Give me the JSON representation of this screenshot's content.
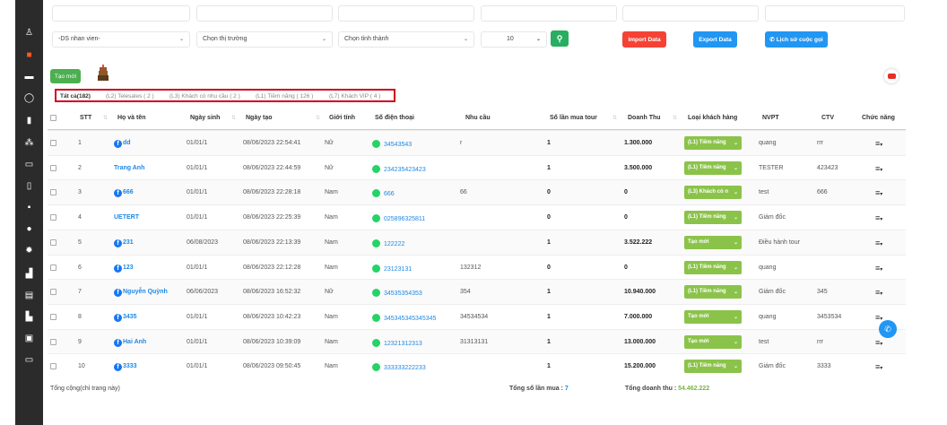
{
  "sidebar": {
    "icons": [
      "user-icon",
      "briefcase-icon",
      "id-card-icon",
      "whatsapp-icon",
      "document-icon",
      "network-icon",
      "card-icon",
      "clipboard-icon",
      "visa-icon",
      "circle-icon",
      "gear-icon",
      "chart-icon",
      "calculator-icon",
      "bar-chart-icon",
      "building-icon",
      "monitor-icon"
    ]
  },
  "filters": {
    "staff": "-DS nhan vien-",
    "market": "Chọn thị trường",
    "province": "Chọn tỉnh thành",
    "page_size": "10"
  },
  "buttons": {
    "import": "Import Data",
    "export": "Export Data",
    "call_history": "Lịch sử cuộc gọi",
    "create": "Tạo mới"
  },
  "tabs": [
    "Tất cả(182)",
    "(L2) Telesales ( 2 )",
    "(L3) Khách có nhu cầu ( 2 )",
    "(L1) Tiềm năng ( 126 )",
    "(L7) Khách VIP ( 4 )"
  ],
  "table": {
    "headers": [
      "STT",
      "Họ và tên",
      "Ngày sinh",
      "Ngày tạo",
      "Giới tính",
      "Số điện thoại",
      "Nhu cầu",
      "Số lần mua tour",
      "Doanh Thu",
      "Loại khách hàng",
      "NVPT",
      "CTV",
      "Chức năng"
    ],
    "rows": [
      {
        "stt": "1",
        "name": "dd",
        "fb": true,
        "dob": "01/01/1",
        "created": "08/06/2023 22:54:41",
        "gender": "Nữ",
        "phone": "34543543",
        "need": "r",
        "tours": "1",
        "revenue": "1.300.000",
        "type": "(L1) Tiềm năng",
        "nvpt": "quang",
        "ctv": "rrr"
      },
      {
        "stt": "2",
        "name": "Trang Anh",
        "fb": false,
        "dob": "01/01/1",
        "created": "08/06/2023 22:44:59",
        "gender": "Nữ",
        "phone": "234235423423",
        "need": "",
        "tours": "1",
        "revenue": "3.500.000",
        "type": "(L1) Tiềm năng",
        "nvpt": "TESTER",
        "ctv": "423423"
      },
      {
        "stt": "3",
        "name": "666",
        "fb": true,
        "dob": "01/01/1",
        "created": "08/06/2023 22:28:18",
        "gender": "Nam",
        "phone": "666",
        "need": "66",
        "tours": "0",
        "revenue": "0",
        "type": "(L3) Khách có n",
        "nvpt": "test",
        "ctv": "666"
      },
      {
        "stt": "4",
        "name": "UETERT",
        "fb": false,
        "dob": "01/01/1",
        "created": "08/06/2023 22:25:39",
        "gender": "Nam",
        "phone": "025896325811",
        "need": "",
        "tours": "0",
        "revenue": "0",
        "type": "(L1) Tiềm năng",
        "nvpt": "Giám đốc",
        "ctv": ""
      },
      {
        "stt": "5",
        "name": "231",
        "fb": true,
        "dob": "06/08/2023",
        "created": "08/06/2023 22:13:39",
        "gender": "Nam",
        "phone": "122222",
        "need": "",
        "tours": "1",
        "revenue": "3.522.222",
        "type": "Tạo mới",
        "nvpt": "Điều hành tour",
        "ctv": ""
      },
      {
        "stt": "6",
        "name": "123",
        "fb": true,
        "dob": "01/01/1",
        "created": "08/06/2023 22:12:28",
        "gender": "Nam",
        "phone": "23123131",
        "need": "132312",
        "tours": "0",
        "revenue": "0",
        "type": "(L1) Tiềm năng",
        "nvpt": "quang",
        "ctv": ""
      },
      {
        "stt": "7",
        "name": "Nguyễn Quỳnh",
        "fb": true,
        "dob": "06/06/2023",
        "created": "08/06/2023 16:52:32",
        "gender": "Nữ",
        "phone": "34535354353",
        "need": "354",
        "tours": "1",
        "revenue": "10.940.000",
        "type": "(L1) Tiềm năng",
        "nvpt": "Giám đốc",
        "ctv": "345"
      },
      {
        "stt": "8",
        "name": "3435",
        "fb": true,
        "dob": "01/01/1",
        "created": "08/06/2023 10:42:23",
        "gender": "Nam",
        "phone": "345345345345345",
        "need": "34534534",
        "tours": "1",
        "revenue": "7.000.000",
        "type": "Tạo mới",
        "nvpt": "quang",
        "ctv": "3453534"
      },
      {
        "stt": "9",
        "name": "Hai Anh",
        "fb": true,
        "dob": "01/01/1",
        "created": "08/06/2023 10:39:09",
        "gender": "Nam",
        "phone": "12321312313",
        "need": "31313131",
        "tours": "1",
        "revenue": "13.000.000",
        "type": "Tạo mới",
        "nvpt": "test",
        "ctv": "rrr"
      },
      {
        "stt": "10",
        "name": "3333",
        "fb": true,
        "dob": "01/01/1",
        "created": "08/06/2023 09:50:45",
        "gender": "Nam",
        "phone": "333333222233",
        "need": "",
        "tours": "1",
        "revenue": "15.200.000",
        "type": "(L1) Tiềm năng",
        "nvpt": "Giám đốc",
        "ctv": "3333"
      }
    ]
  },
  "footer": {
    "page_total": "Tổng cộng(chỉ trang này)",
    "tours_label": "Tổng số lần mua :",
    "tours_value": "7",
    "revenue_label": "Tổng doanh thu :",
    "revenue_value": "54.462.222"
  },
  "colors": {
    "sidebar": "#2b2b2b",
    "import": "#f44336",
    "export": "#2196f3",
    "create": "#4caf50",
    "pill": "#8bc34a",
    "tabs_border": "#d0021b"
  }
}
